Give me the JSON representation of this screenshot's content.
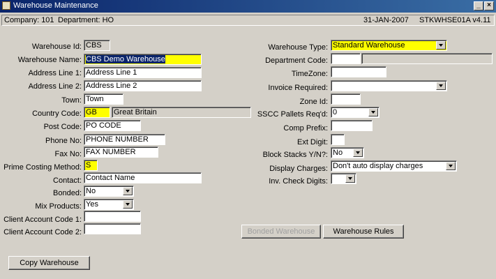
{
  "window": {
    "title": "Warehouse Maintenance"
  },
  "status": {
    "company": "Company: 101",
    "department": "Department: HO",
    "date": "31-JAN-2007",
    "module": "STKWHSE01A v4.11"
  },
  "left": {
    "warehouse_id": {
      "label": "Warehouse Id:",
      "value": "CBS"
    },
    "warehouse_name": {
      "label": "Warehouse Name:",
      "value": "CBS Demo Warehouse"
    },
    "address1": {
      "label": "Address Line 1:",
      "value": "Address Line 1"
    },
    "address2": {
      "label": "Address Line 2:",
      "value": "Address Line 2"
    },
    "town": {
      "label": "Town:",
      "value": "Town"
    },
    "country": {
      "label": "Country Code:",
      "code": "GB",
      "name": "Great Britain"
    },
    "post_code": {
      "label": "Post Code:",
      "value": "PO CODE"
    },
    "phone": {
      "label": "Phone No:",
      "value": "PHONE NUMBER"
    },
    "fax": {
      "label": "Fax No:",
      "value": "FAX NUMBER"
    },
    "prime_costing": {
      "label": "Prime Costing Method:",
      "value": "S"
    },
    "contact": {
      "label": "Contact:",
      "value": "Contact Name"
    },
    "bonded": {
      "label": "Bonded:",
      "value": "No"
    },
    "mix_products": {
      "label": "Mix Products:",
      "value": "Yes"
    },
    "client_account1": {
      "label": "Client Account Code 1:",
      "value": ""
    },
    "client_account2": {
      "label": "Client Account Code 2:",
      "value": ""
    }
  },
  "right": {
    "warehouse_type": {
      "label": "Warehouse Type:",
      "value": "Standard Warehouse"
    },
    "department_code": {
      "label": "Department Code:",
      "value": ""
    },
    "timezone": {
      "label": "TimeZone:",
      "value": ""
    },
    "invoice_required": {
      "label": "Invoice Required:",
      "value": ""
    },
    "zone_id": {
      "label": "Zone Id:",
      "value": ""
    },
    "sscc_pallets": {
      "label": "SSCC Pallets Req'd:",
      "value": "0"
    },
    "comp_prefix": {
      "label": "Comp Prefix:",
      "value": ""
    },
    "ext_digit": {
      "label": "Ext Digit:",
      "value": ""
    },
    "block_stacks": {
      "label": "Block Stacks Y/N?:",
      "value": "No"
    },
    "display_charges": {
      "label": "Display Charges:",
      "value": "Don't auto display charges"
    },
    "inv_check_digits": {
      "label": "Inv. Check Digits:",
      "value": ""
    }
  },
  "buttons": {
    "bonded_warehouse": "Bonded Warehouse",
    "warehouse_rules": "Warehouse Rules",
    "copy_warehouse": "Copy Warehouse"
  }
}
